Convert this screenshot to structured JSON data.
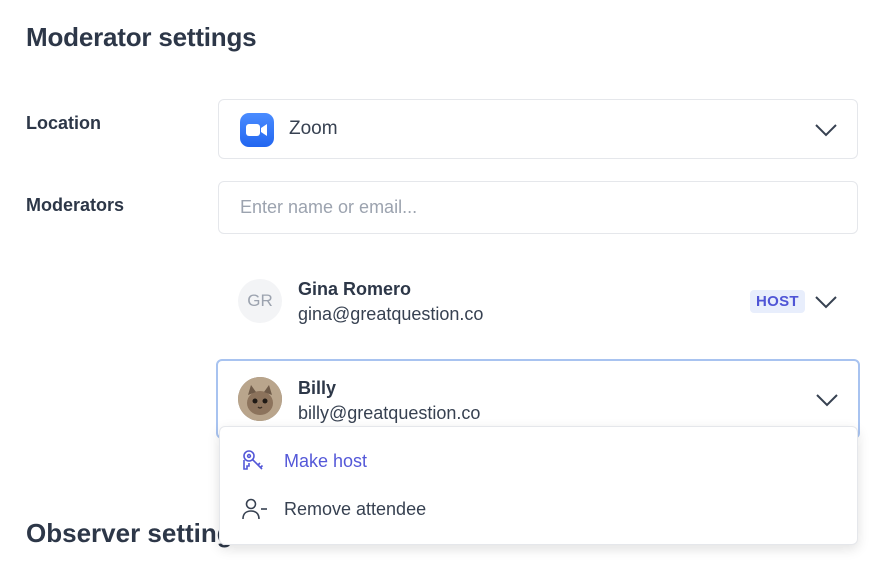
{
  "page": {
    "title": "Moderator settings",
    "observer_title": "Observer settings"
  },
  "location": {
    "label": "Location",
    "value": "Zoom",
    "icon": "zoom-icon",
    "accent": "#2D8CFF"
  },
  "moderators": {
    "label": "Moderators",
    "placeholder": "Enter name or email...",
    "list": [
      {
        "initials": "GR",
        "name": "Gina Romero",
        "email": "gina@greatquestion.co",
        "badge": "HOST"
      },
      {
        "name": "Billy",
        "email": "billy@greatquestion.co",
        "avatar": "cat-photo"
      }
    ]
  },
  "menu": {
    "items": [
      {
        "label": "Make host",
        "icon": "keys-icon",
        "color": "#5458D8"
      },
      {
        "label": "Remove attendee",
        "icon": "user-minus-icon",
        "color": "#374151"
      }
    ]
  }
}
